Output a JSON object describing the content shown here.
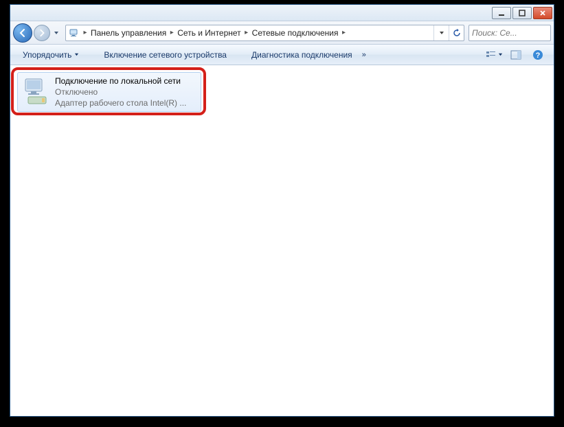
{
  "breadcrumb": {
    "items": [
      {
        "label": "Панель управления"
      },
      {
        "label": "Сеть и Интернет"
      },
      {
        "label": "Сетевые подключения"
      }
    ]
  },
  "search": {
    "placeholder": "Поиск: Се..."
  },
  "toolbar": {
    "organize": "Упорядочить",
    "enable_device": "Включение сетевого устройства",
    "diagnose": "Диагностика подключения"
  },
  "connection": {
    "title": "Подключение по локальной сети",
    "status": "Отключено",
    "device": "Адаптер рабочего стола Intel(R) ..."
  }
}
